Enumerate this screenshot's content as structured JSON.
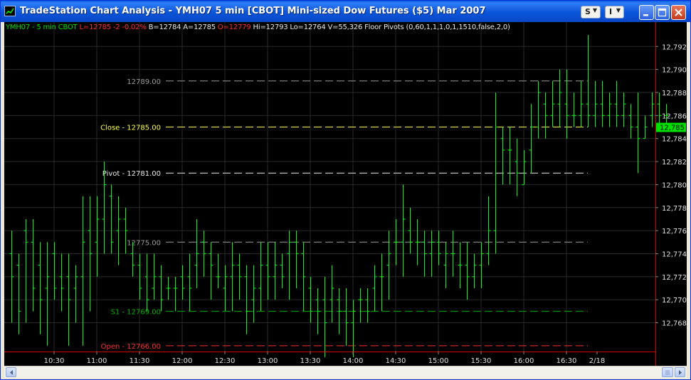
{
  "window": {
    "title": "TradeStation Chart Analysis - YMH07  5 min  [CBOT] Mini-sized Dow Futures ($5) Mar 2007",
    "buttons": {
      "s_label": "S",
      "i_label": "I"
    }
  },
  "status": {
    "symbol_text": "YMH07 - 5 min  CBOT",
    "last_text": "L=12785  -2  -0.02%",
    "bid_text": "B=12784",
    "ask_text": "A=12785",
    "open_text": "O=12779",
    "rest_text": "Hi=12793  Lo=12764  V=55,326  Floor Pivots (0,60,1,1,1,0,1,1510,false,2,0)"
  },
  "pivot_labels": [
    {
      "text": "12789.00",
      "value": 12789,
      "color": "#9a9a9a",
      "line_color": "#9a9a9a"
    },
    {
      "text": "Close - 12785.00",
      "value": 12785,
      "color": "#ffff40",
      "line_color": "#ffff40"
    },
    {
      "text": "Pivot - 12781.00",
      "value": 12781,
      "color": "#e8e8e8",
      "line_color": "#e8e8e8"
    },
    {
      "text": "12775.00",
      "value": 12775,
      "color": "#9a9a9a",
      "line_color": "#9a9a9a"
    },
    {
      "text": "S1 - 12769.00",
      "value": 12769,
      "color": "#00b000",
      "line_color": "#00b000"
    },
    {
      "text": "Open - 12766.00",
      "value": 12766,
      "color": "#ff3030",
      "line_color": "#ff3030"
    }
  ],
  "last_price_tag": "12,785",
  "colors": {
    "bars": "#00ff00",
    "grid": "#2a2a2a",
    "separator": "#d00000",
    "axis_text": "#e0e0e0"
  },
  "chart_data": {
    "type": "bar",
    "subtype": "ohlc",
    "title": "YMH07 - 5 min",
    "ylim": [
      12765.5,
      12793.5
    ],
    "y_ticks": [
      "12,768",
      "12,770",
      "12,772",
      "12,774",
      "12,776",
      "12,778",
      "12,780",
      "12,782",
      "12,784",
      "12,786",
      "12,788",
      "12,790",
      "12,792"
    ],
    "y_tick_values": [
      12768,
      12770,
      12772,
      12774,
      12776,
      12778,
      12780,
      12782,
      12784,
      12786,
      12788,
      12790,
      12792
    ],
    "x_ticks": [
      "10:30",
      "11:00",
      "11:30",
      "12:00",
      "12:30",
      "13:00",
      "13:30",
      "14:00",
      "14:30",
      "15:00",
      "15:30",
      "16:00",
      "16:30",
      "2/18"
    ],
    "bar_interval_minutes": 5,
    "bars": [
      [
        "10:00",
        12774,
        12776,
        12768,
        12772
      ],
      [
        "10:05",
        12773,
        12774,
        12767,
        12769
      ],
      [
        "10:10",
        12776,
        12777,
        12768,
        12775
      ],
      [
        "10:15",
        12775,
        12777,
        12769,
        12771
      ],
      [
        "10:20",
        12773,
        12775,
        12767,
        12770
      ],
      [
        "10:25",
        12771,
        12775,
        12766,
        12772
      ],
      [
        "10:30",
        12774,
        12775,
        12770,
        12771
      ],
      [
        "10:35",
        12772,
        12774,
        12769,
        12771
      ],
      [
        "10:40",
        12772,
        12774,
        12766,
        12770
      ],
      [
        "10:45",
        12771,
        12773,
        12768,
        12772
      ],
      [
        "10:50",
        12772,
        12779,
        12766,
        12775
      ],
      [
        "10:55",
        12776,
        12779,
        12769,
        12774
      ],
      [
        "11:00",
        12775,
        12779,
        12772,
        12777
      ],
      [
        "11:05",
        12777,
        12782,
        12774,
        12780
      ],
      [
        "11:10",
        12779,
        12780,
        12774,
        12775
      ],
      [
        "11:15",
        12776,
        12779,
        12773,
        12777
      ],
      [
        "11:20",
        12777,
        12778,
        12774,
        12776
      ],
      [
        "11:25",
        12774,
        12775,
        12772,
        12773
      ],
      [
        "11:30",
        12773,
        12774,
        12770,
        12771
      ],
      [
        "11:35",
        12772,
        12774,
        12769,
        12770
      ],
      [
        "11:40",
        12771,
        12774,
        12770,
        12772
      ],
      [
        "11:45",
        12772,
        12773,
        12769,
        12770
      ],
      [
        "11:50",
        12771,
        12772,
        12770,
        12771
      ],
      [
        "11:55",
        12771,
        12772,
        12769,
        12771
      ],
      [
        "12:00",
        12772,
        12773,
        12770,
        12771
      ],
      [
        "12:05",
        12772,
        12774,
        12769,
        12771
      ],
      [
        "12:10",
        12773,
        12777,
        12771,
        12774
      ],
      [
        "12:15",
        12775,
        12776,
        12772,
        12774
      ],
      [
        "12:20",
        12774,
        12775,
        12770,
        12773
      ],
      [
        "12:25",
        12772,
        12774,
        12771,
        12772
      ],
      [
        "12:30",
        12771,
        12773,
        12769,
        12772
      ],
      [
        "12:35",
        12772,
        12775,
        12769,
        12773
      ],
      [
        "12:40",
        12773,
        12774,
        12770,
        12772
      ],
      [
        "12:45",
        12772,
        12773,
        12767,
        12769
      ],
      [
        "12:50",
        12770,
        12773,
        12768,
        12771
      ],
      [
        "12:55",
        12771,
        12775,
        12769,
        12773
      ],
      [
        "13:00",
        12773,
        12775,
        12770,
        12772
      ],
      [
        "13:05",
        12772,
        12775,
        12770,
        12773
      ],
      [
        "13:10",
        12773,
        12774,
        12771,
        12772
      ],
      [
        "13:15",
        12774,
        12776,
        12770,
        12775
      ],
      [
        "13:20",
        12775,
        12776,
        12771,
        12774
      ],
      [
        "13:25",
        12774,
        12775,
        12769,
        12772
      ],
      [
        "13:30",
        12771,
        12772,
        12768,
        12769
      ],
      [
        "13:35",
        12770,
        12771,
        12767,
        12769
      ],
      [
        "13:40",
        12770,
        12772,
        12765,
        12768
      ],
      [
        "13:45",
        12770,
        12773,
        12768,
        12771
      ],
      [
        "13:50",
        12770,
        12771,
        12767,
        12769
      ],
      [
        "13:55",
        12769,
        12771,
        12766,
        12768
      ],
      [
        "14:00",
        12768,
        12770,
        12765,
        12769
      ],
      [
        "14:05",
        12770,
        12771,
        12768,
        12770
      ],
      [
        "14:10",
        12770,
        12771,
        12768,
        12769
      ],
      [
        "14:15",
        12771,
        12773,
        12769,
        12772
      ],
      [
        "14:20",
        12772,
        12774,
        12769,
        12772
      ],
      [
        "14:25",
        12773,
        12776,
        12770,
        12774
      ],
      [
        "14:30",
        12775,
        12777,
        12773,
        12775
      ],
      [
        "14:35",
        12775,
        12780,
        12772,
        12777
      ],
      [
        "14:40",
        12776,
        12778,
        12774,
        12775
      ],
      [
        "14:45",
        12775,
        12777,
        12773,
        12775
      ],
      [
        "14:50",
        12775,
        12776,
        12772,
        12774
      ],
      [
        "14:55",
        12774,
        12776,
        12772,
        12775
      ],
      [
        "15:00",
        12775,
        12776,
        12773,
        12774
      ],
      [
        "15:05",
        12773,
        12775,
        12771,
        12774
      ],
      [
        "15:10",
        12774,
        12776,
        12772,
        12774
      ],
      [
        "15:15",
        12773,
        12775,
        12771,
        12773
      ],
      [
        "15:20",
        12773,
        12775,
        12770,
        12772
      ],
      [
        "15:25",
        12772,
        12774,
        12771,
        12773
      ],
      [
        "15:30",
        12773,
        12775,
        12771,
        12774
      ],
      [
        "15:35",
        12774,
        12779,
        12773,
        12776
      ],
      [
        "15:40",
        12776,
        12788,
        12774,
        12785
      ],
      [
        "15:45",
        12784,
        12785,
        12780,
        12783
      ],
      [
        "15:50",
        12783,
        12785,
        12780,
        12783
      ],
      [
        "15:55",
        12782,
        12784,
        12779,
        12781
      ],
      [
        "16:00",
        12780,
        12783,
        12780,
        12782
      ],
      [
        "16:05",
        12783,
        12787,
        12781,
        12785
      ],
      [
        "16:10",
        12785,
        12789,
        12784,
        12788
      ],
      [
        "16:15",
        12787,
        12788,
        12784,
        12786
      ],
      [
        "16:20",
        12786,
        12789,
        12785,
        12787
      ],
      [
        "16:25",
        12787,
        12790,
        12785,
        12788
      ],
      [
        "16:30",
        12787,
        12790,
        12784,
        12786
      ],
      [
        "16:35",
        12786,
        12788,
        12785,
        12786
      ],
      [
        "16:40",
        12786,
        12789,
        12785,
        12787
      ],
      [
        "16:45",
        12787,
        12793,
        12785,
        12786
      ],
      [
        "16:50",
        12786,
        12789,
        12785,
        12787
      ],
      [
        "16:55",
        12787,
        12789,
        12785,
        12786
      ],
      [
        "17:00",
        12786,
        12788,
        12785,
        12787
      ],
      [
        "17:05",
        12787,
        12789,
        12785,
        12786
      ],
      [
        "17:10",
        12786,
        12788,
        12785,
        12787
      ],
      [
        "17:15",
        12786,
        12787,
        12784,
        12785
      ],
      [
        "17:20",
        12785,
        12788,
        12781,
        12784
      ],
      [
        "17:25",
        12784,
        12786,
        12784,
        12785
      ],
      [
        "17:30",
        12786,
        12788,
        12785,
        12787
      ],
      [
        "17:35",
        12787,
        12788,
        12785,
        12786
      ],
      [
        "17:40",
        12786,
        12787,
        12785,
        12786
      ]
    ]
  }
}
